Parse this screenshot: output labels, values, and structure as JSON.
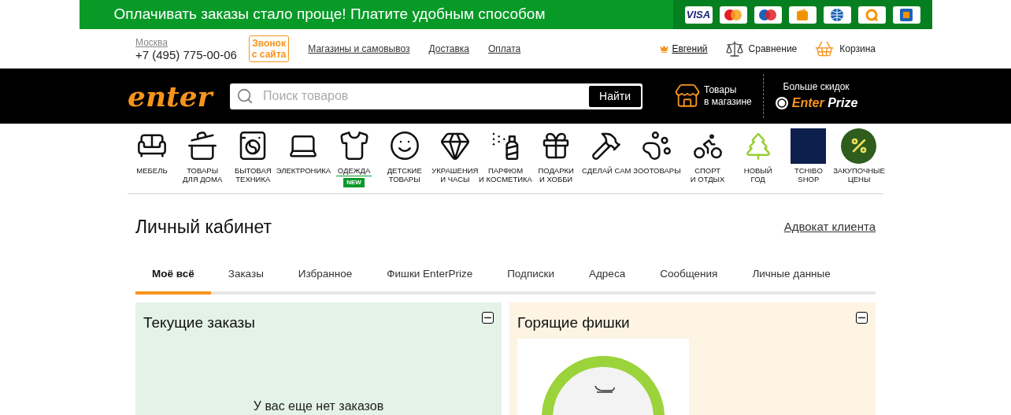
{
  "promo_banner": {
    "text": "Оплачивать заказы стало проще! Платите удобным способом",
    "payment_methods": [
      {
        "kind": "visa",
        "label": "VISA"
      },
      {
        "kind": "mastercard"
      },
      {
        "kind": "maestro"
      },
      {
        "kind": "wallet"
      },
      {
        "kind": "webmoney"
      },
      {
        "kind": "qiwi"
      },
      {
        "kind": "rfi"
      }
    ]
  },
  "top_bar": {
    "city": "Москва",
    "phone": "+7 (495) 775-00-06",
    "callback_button": [
      "Звонок",
      "с сайта"
    ],
    "links": [
      "Магазины и самовывоз",
      "Доставка",
      "Оплата"
    ],
    "user": "Евгений",
    "compare": "Сравнение",
    "cart": "Корзина"
  },
  "header": {
    "logo": "enter",
    "search": {
      "placeholder": "Поиск товаров",
      "button": "Найти"
    },
    "store_goods": [
      "Товары",
      "в магазине"
    ],
    "prize": {
      "caption": "Больше скидок",
      "title_1": "Enter",
      "title_2": "Prize"
    }
  },
  "categories": [
    {
      "kind": "sofa",
      "lines": [
        "МЕБЕЛЬ"
      ]
    },
    {
      "kind": "pot",
      "lines": [
        "ТОВАРЫ",
        "ДЛЯ ДОМА"
      ]
    },
    {
      "kind": "washer",
      "lines": [
        "БЫТОВАЯ",
        "ТЕХНИКА"
      ]
    },
    {
      "kind": "laptop",
      "lines": [
        "ЭЛЕКТРОНИКА"
      ]
    },
    {
      "kind": "shirt",
      "lines": [
        "ОДЕЖДА"
      ],
      "badge": "NEW"
    },
    {
      "kind": "bear",
      "lines": [
        "ДЕТСКИЕ",
        "ТОВАРЫ"
      ]
    },
    {
      "kind": "gem",
      "lines": [
        "УКРАШЕНИЯ",
        "И ЧАСЫ"
      ]
    },
    {
      "kind": "perfume",
      "lines": [
        "ПАРФЮМ",
        "И КОСМЕТИКА"
      ]
    },
    {
      "kind": "gift",
      "lines": [
        "ПОДАРКИ",
        "И ХОББИ"
      ]
    },
    {
      "kind": "tools",
      "lines": [
        "СДЕЛАЙ САМ"
      ]
    },
    {
      "kind": "paw",
      "lines": [
        "ЗООТОВАРЫ"
      ]
    },
    {
      "kind": "bike",
      "lines": [
        "СПОРТ",
        "И ОТДЫХ"
      ]
    },
    {
      "kind": "tree",
      "lines": [
        "НОВЫЙ",
        "ГОД"
      ]
    },
    {
      "kind": "tchibo",
      "lines": [
        "TCHIBO",
        "SHOP"
      ]
    },
    {
      "kind": "sale",
      "lines": [
        "ЗАКУПОЧНЫЕ",
        "ЦЕНЫ"
      ]
    }
  ],
  "page": {
    "title": "Личный кабинет",
    "advocate_link": "Адвокат клиента"
  },
  "tabs": [
    {
      "label": "Моё всё",
      "selected": true
    },
    {
      "label": "Заказы",
      "selected": false
    },
    {
      "label": "Избранное",
      "selected": false
    },
    {
      "label": "Фишки EnterPrize",
      "selected": false
    },
    {
      "label": "Подписки",
      "selected": false
    },
    {
      "label": "Адреса",
      "selected": false
    },
    {
      "label": "Сообщения",
      "selected": false
    },
    {
      "label": "Личные данные",
      "selected": false
    }
  ],
  "panels": [
    {
      "kind": "orders",
      "title": "Текущие заказы",
      "empty_text": "У вас еще нет заказов"
    },
    {
      "kind": "chips",
      "title": "Горящие фишки"
    }
  ]
}
